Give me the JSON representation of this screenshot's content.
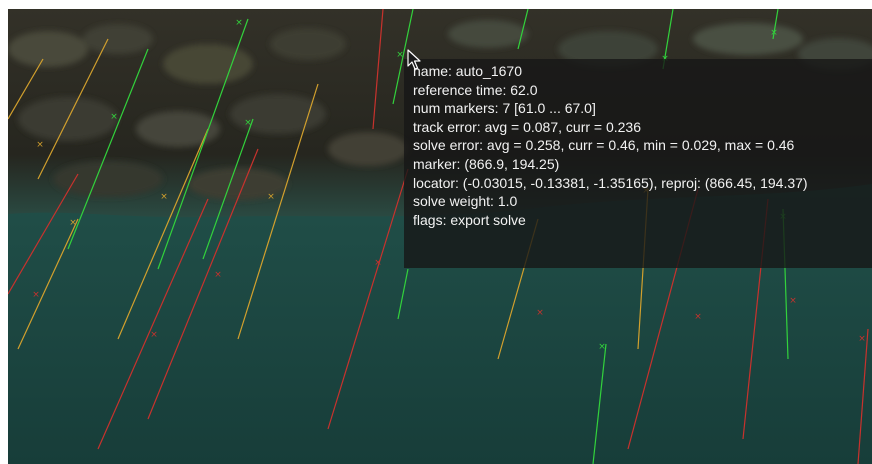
{
  "viewport": {
    "mode": "clip-tracking-view",
    "colors": {
      "background_water": "#1e4a45",
      "background_rocks": "#2b2c25",
      "track_inlier": "#32d23c",
      "track_mid": "#d2a02d",
      "track_outlier": "#c8322d"
    }
  },
  "info": {
    "name": "name: auto_1670",
    "reference_time": "reference time: 62.0",
    "num_markers": "num markers: 7 [61.0 ... 67.0]",
    "track_error": "track error: avg = 0.087, curr = 0.236",
    "solve_error": "solve error: avg = 0.258, curr = 0.46, min = 0.029, max = 0.46",
    "marker": "marker: (866.9, 194.25)",
    "locator": "locator: (-0.03015, -0.13381, -1.35165), reproj: (866.45, 194.37)",
    "solve_weight": "solve weight: 1.0",
    "flags": "flags: export solve"
  },
  "cursor": {
    "icon": "arrow-cursor-icon"
  }
}
